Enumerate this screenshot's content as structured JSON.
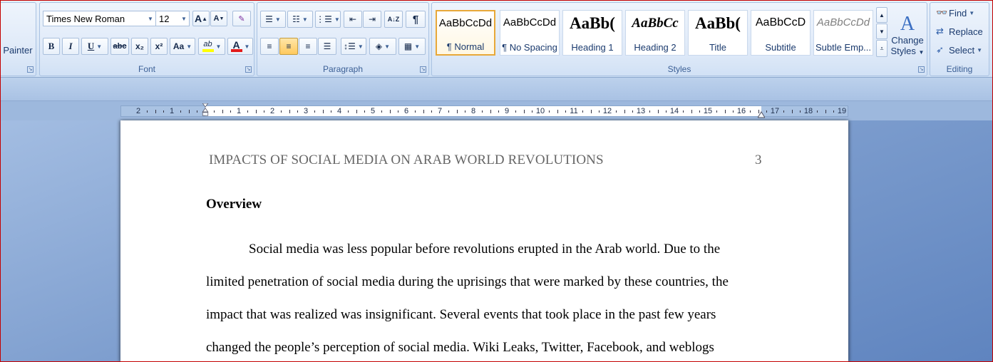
{
  "clipboard": {
    "painter_label": "Painter"
  },
  "font": {
    "group_label": "Font",
    "name": "Times New Roman",
    "size": "12",
    "grow_label": "A",
    "shrink_label": "A",
    "bold": "B",
    "italic": "I",
    "underline": "U",
    "strike": "abc",
    "subscript": "x₂",
    "superscript": "x²",
    "change_case": "Aa",
    "highlight": "ab",
    "font_color": "A",
    "highlight_color": "#ffff00",
    "font_color_value": "#e21b1b"
  },
  "paragraph": {
    "group_label": "Paragraph",
    "show_marks": "¶",
    "sort": "A↓Z"
  },
  "styles": {
    "group_label": "Styles",
    "tiles": [
      {
        "sample": "AaBbCcDd",
        "name": "¶ Normal"
      },
      {
        "sample": "AaBbCcDd",
        "name": "¶ No Spacing"
      },
      {
        "sample": "AaBb(",
        "name": "Heading 1"
      },
      {
        "sample": "AaBbCc",
        "name": "Heading 2"
      },
      {
        "sample": "AaBb(",
        "name": "Title"
      },
      {
        "sample": "AaBbCcD",
        "name": "Subtitle"
      },
      {
        "sample": "AaBbCcDd",
        "name": "Subtle Emp..."
      }
    ],
    "change_styles_label": [
      "Change",
      "Styles"
    ]
  },
  "editing": {
    "group_label": "Editing",
    "find": "Find",
    "replace": "Replace",
    "select": "Select"
  },
  "ruler": {
    "numbers": [
      "2",
      "1",
      "1",
      "2",
      "3",
      "4",
      "5",
      "6",
      "7",
      "8",
      "9",
      "10",
      "11",
      "12",
      "13",
      "14",
      "15",
      "16",
      "17",
      "18",
      "19"
    ]
  },
  "document": {
    "header_title": "IMPACTS OF SOCIAL MEDIA ON ARAB WORLD REVOLUTIONS",
    "page_number": "3",
    "heading": "Overview",
    "lines": [
      "Social media was less popular before revolutions erupted in the Arab world. Due to the",
      "limited penetration of social media during the uprisings that were marked by these countries, the",
      "impact that was realized was insignificant. Several events that took place in the past few years",
      "changed the people’s perception of social media. Wiki Leaks, Twitter, Facebook, and weblogs"
    ]
  }
}
